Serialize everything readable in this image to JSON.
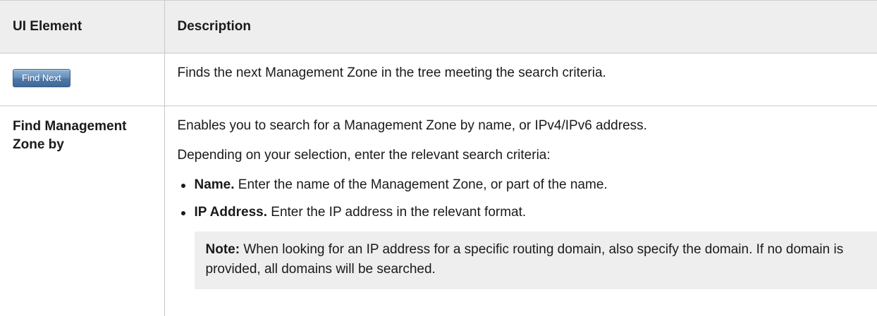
{
  "table": {
    "headers": [
      "UI Element",
      "Description"
    ],
    "rows": [
      {
        "button_label": "Find Next",
        "description": "Finds the next Management Zone in the tree meeting the search criteria."
      },
      {
        "element_label": "Find Management Zone by",
        "intro": "Enables you to search for a Management Zone by name, or IPv4/IPv6 address.",
        "instruction": "Depending on your selection, enter the relevant search criteria:",
        "options": [
          {
            "term": "Name.",
            "text": " Enter the name of the Management Zone, or part of the name."
          },
          {
            "term": "IP Address.",
            "text": " Enter the IP address in the relevant format."
          }
        ],
        "note_label": "Note:",
        "note_text": " When looking for an IP address for a specific routing domain, also specify the domain. If no domain is provided, all domains will be searched."
      }
    ]
  }
}
